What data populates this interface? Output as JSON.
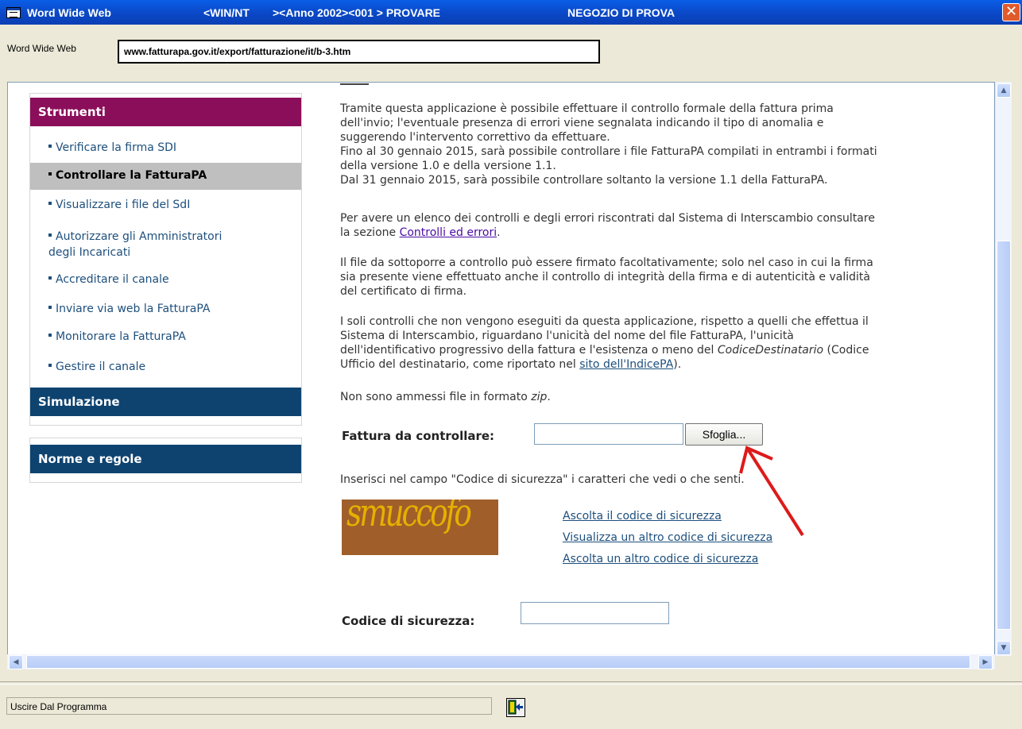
{
  "window": {
    "title": "Word Wide Web",
    "segment_os": "<WIN/NT",
    "segment_year": "><Anno 2002><001 > PROVARE",
    "segment_shop": "NEGOZIO DI PROVA",
    "close_glyph": "✕"
  },
  "address": {
    "label": "Word Wide Web",
    "url": "www.fatturapa.gov.it/export/fatturazione/it/b-3.htm"
  },
  "menu": {
    "section_tools": "Strumenti",
    "items": [
      "Verificare la firma SDI",
      "Controllare la FatturaPA",
      "Visualizzare i file del SdI",
      "Autorizzare gli Amministratori",
      "degli Incaricati",
      "Accreditare il canale",
      "Inviare via web la FatturaPA",
      "Monitorare la FatturaPA",
      "Gestire il canale"
    ],
    "section_simulation": "Simulazione",
    "section_rules": "Norme e regole"
  },
  "content": {
    "p1_l1": "Tramite questa applicazione è possibile effettuare il controllo formale della fattura prima",
    "p1_l2": "dell'invio; l'eventuale presenza di errori viene segnalata indicando il tipo di anomalia e",
    "p1_l3": "suggerendo l'intervento correttivo da effettuare.",
    "p1_l4": "Fino al 30 gennaio 2015, sarà possibile controllare i file FatturaPA compilati in entrambi i formati",
    "p1_l5": "della versione 1.0 e della versione 1.1.",
    "p1_l6": "Dal 31 gennaio 2015, sarà possibile controllare soltanto la versione 1.1 della FatturaPA.",
    "p2_l1": "Per avere un elenco dei controlli e degli errori riscontrati dal Sistema di Interscambio consultare",
    "p2_l2_pre": "la sezione ",
    "p2_link": "Controlli ed errori",
    "p2_l2_post": ".",
    "p3_l1": "Il file da sottoporre a controllo può essere firmato facoltativamente; solo nel caso in cui la firma",
    "p3_l2": "sia presente viene effettuato anche il controllo di integrità della firma e di autenticità e validità",
    "p3_l3": "del certificato di firma.",
    "p4_l1": "I soli controlli che non vengono eseguiti da questa applicazione, rispetto a quelli che effettua il",
    "p4_l2": "Sistema di Interscambio, riguardano l'unicità del nome del file FatturaPA, l'unicità",
    "p4_l3_pre": "dell'identificativo progressivo della fattura e l'esistenza o meno del ",
    "p4_l3_em": "CodiceDestinatario",
    "p4_l3_post": " (Codice",
    "p4_l4_pre": "Ufficio del destinatario, come riportato nel ",
    "p4_link": "sito dell'IndicePA",
    "p4_l4_post": ").",
    "p5_pre": "Non sono ammessi file in formato ",
    "p5_em": "zip",
    "p5_post": ".",
    "file_label": "Fattura da controllare:",
    "file_value": "",
    "browse_button": "Sfoglia...",
    "captcha_instruction": "Inserisci nel campo \"Codice di sicurezza\" i caratteri che vedi o che senti.",
    "captcha_image_text": "smuccofo",
    "captcha_links": [
      "Ascolta il codice di sicurezza",
      "Visualizza un altro codice di sicurezza",
      "Ascolta un altro codice di sicurezza"
    ],
    "security_label": "Codice di sicurezza:",
    "security_value": ""
  },
  "status": {
    "text": "Uscire Dal Programma"
  },
  "colors": {
    "titlebar": "#0a49c9",
    "menu_tools": "#8b0e5b",
    "menu_blue": "#0e4370",
    "arrow": "#dd1a1a"
  }
}
